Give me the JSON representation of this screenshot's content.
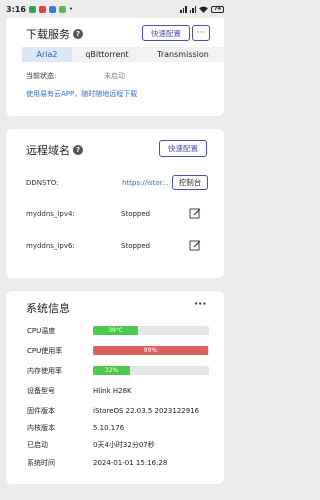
{
  "statusbar": {
    "time": "3:16",
    "battery": "74"
  },
  "download": {
    "title": "下载服务",
    "quick_label": "快速配置",
    "more_label": "···",
    "tabs": [
      "Aria2",
      "qBittorrent",
      "Transmission"
    ],
    "active_tab": 0,
    "status_label": "当前状态:",
    "status_value": "未启动",
    "app_link": "使用易有云APP，随时随地远程下载"
  },
  "remote": {
    "title": "远程域名",
    "quick_label": "快速配置",
    "rows": [
      {
        "label": "DDNSTO:",
        "value": "https://istor...",
        "button": "控制台"
      },
      {
        "label": "myddns_ipv4:",
        "value": "Stopped"
      },
      {
        "label": "myddns_ipv6:",
        "value": "Stopped"
      }
    ]
  },
  "system": {
    "title": "系统信息",
    "more_label": "···",
    "bars": [
      {
        "label": "CPU温度",
        "value": "39°C",
        "percent": 39,
        "color": "#4cc94c"
      },
      {
        "label": "CPU使用率",
        "value": "99%",
        "percent": 99,
        "color": "#e06060"
      },
      {
        "label": "内存使用率",
        "value": "32%",
        "percent": 32,
        "color": "#4cc94c"
      }
    ],
    "info": [
      {
        "label": "设备型号",
        "value": "Hlink H28K"
      },
      {
        "label": "固件版本",
        "value": "iStoreOS 22.03.5 2023122916"
      },
      {
        "label": "内核版本",
        "value": "5.10.176"
      },
      {
        "label": "已启动",
        "value": "0天4小时32分07秒"
      },
      {
        "label": "系统时间",
        "value": "2024-01-01 15:16:28"
      }
    ]
  }
}
